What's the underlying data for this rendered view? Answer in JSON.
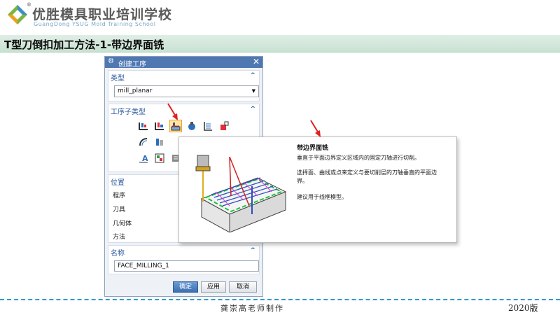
{
  "header": {
    "school_cn": "优胜模具职业培训学校",
    "school_en": "GuangDong YSUG Mold Training School",
    "registered_mark": "®",
    "slide_title": "T型刀倒扣加工方法-1-带边界面铣"
  },
  "dialog": {
    "title": "创建工序",
    "title_icon": "gear-icon",
    "close_label": "✕",
    "type_section": {
      "label": "类型",
      "value": "mill_planar"
    },
    "subtype_section": {
      "label": "工序子类型"
    },
    "location_section": {
      "label": "位置",
      "fields": [
        "程序",
        "刀具",
        "几何体",
        "方法"
      ]
    },
    "name_section": {
      "label": "名称",
      "value": "FACE_MILLING_1"
    },
    "buttons": {
      "ok": "确定",
      "apply": "应用",
      "cancel": "取消"
    }
  },
  "tooltip": {
    "title": "带边界面铣",
    "lines": [
      "垂直于平面边界定义区域内的固定刀轴进行切削。",
      "选择面、曲线或点来定义与要切削层的刀轴垂直的平面边",
      "界。",
      "建议用于线框模型。"
    ]
  },
  "footer": {
    "author": "龚崇高老师制作",
    "version": "2020版"
  },
  "colors": {
    "title_bar": "#c8e2d2",
    "dialog_titlebar": "#4f78b3",
    "section_header": "#2d5aa0",
    "arrow": "#e02020",
    "footer_line": "#2f9bcd"
  }
}
